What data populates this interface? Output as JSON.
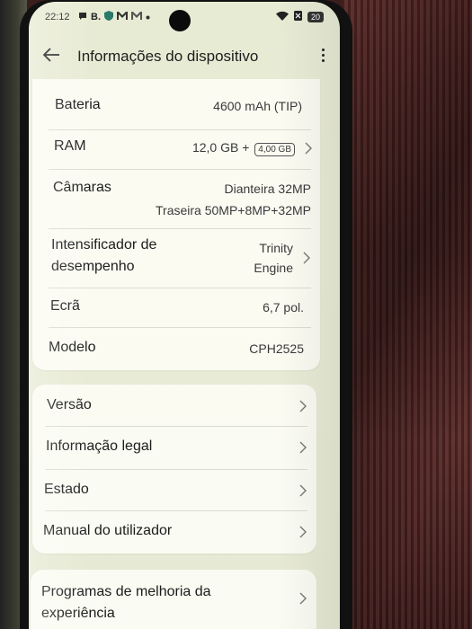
{
  "status": {
    "time": "22:12",
    "left_icons": [
      "message-icon",
      "B.",
      "shield-icon",
      "gmail-icon",
      "gmail-icon",
      "dot"
    ],
    "battery": "20"
  },
  "header": {
    "title": "Informações do dispositivo"
  },
  "specs": [
    {
      "label": "Bateria",
      "value": "4600 mAh (TIP)"
    },
    {
      "label": "RAM",
      "value": "12,0 GB +",
      "badge": "4,00 GB"
    },
    {
      "label": "Câmaras",
      "value_line1": "Dianteira 32MP",
      "value_line2": "Traseira 50MP+8MP+32MP"
    },
    {
      "label_line1": "Intensificador de",
      "label_line2": "desempenho",
      "value_line1": "Trinity",
      "value_line2": "Engine"
    },
    {
      "label": "Ecrã",
      "value": "6,7 pol."
    },
    {
      "label": "Modelo",
      "value": "CPH2525"
    }
  ],
  "links": [
    {
      "label": "Versão"
    },
    {
      "label": "Informação legal"
    },
    {
      "label": "Estado"
    },
    {
      "label": "Manual do utilizador"
    }
  ],
  "programs": {
    "label_line1": "Programas de melhoria da",
    "label_line2": "experiência"
  }
}
